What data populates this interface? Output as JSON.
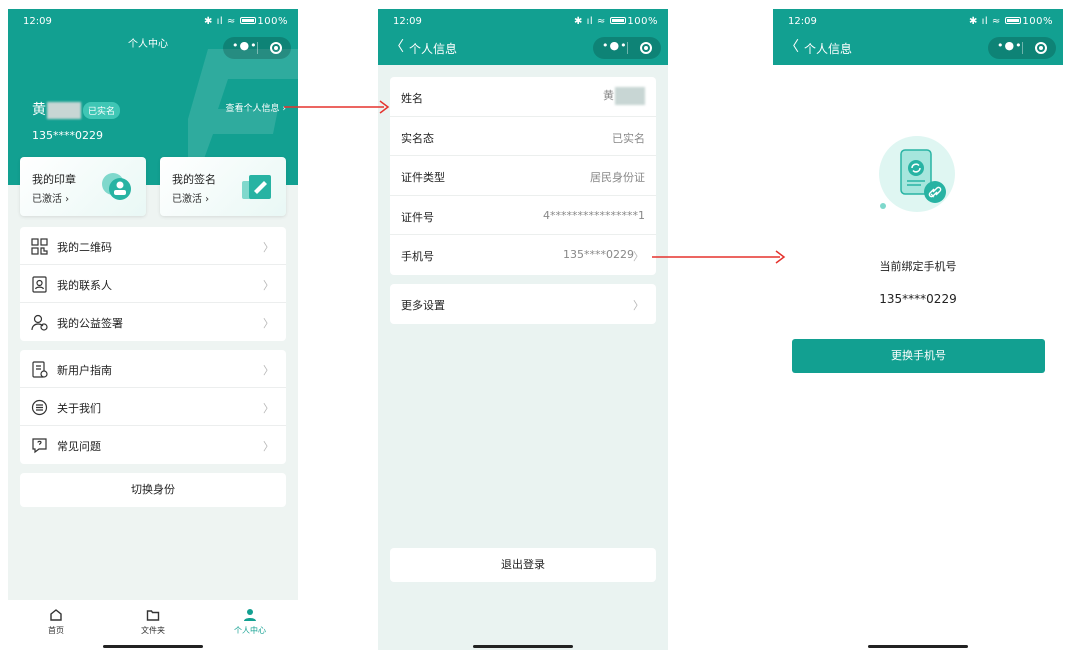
{
  "status": {
    "time": "12:09",
    "right": "100%"
  },
  "screen1": {
    "title": "个人中心",
    "name": "黄",
    "verified_badge": "已实名",
    "phone": "135****0229",
    "view_info": "查看个人信息",
    "cards": [
      {
        "title": "我的印章",
        "status": "已激活",
        "icon": "seal-icon"
      },
      {
        "title": "我的签名",
        "status": "已激活",
        "icon": "signature-icon"
      }
    ],
    "menu1": [
      {
        "label": "我的二维码",
        "icon": "qrcode-icon"
      },
      {
        "label": "我的联系人",
        "icon": "contacts-icon"
      },
      {
        "label": "我的公益签署",
        "icon": "charity-sign-icon"
      }
    ],
    "menu2": [
      {
        "label": "新用户指南",
        "icon": "guide-icon"
      },
      {
        "label": "关于我们",
        "icon": "about-icon"
      },
      {
        "label": "常见问题",
        "icon": "faq-icon"
      }
    ],
    "switch_identity": "切换身份",
    "tabs": [
      {
        "label": "首页",
        "icon": "home-icon"
      },
      {
        "label": "文件夹",
        "icon": "folder-icon"
      },
      {
        "label": "个人中心",
        "icon": "user-icon"
      }
    ]
  },
  "screen2": {
    "title": "个人信息",
    "rows": [
      {
        "key": "姓名",
        "value": "黄"
      },
      {
        "key": "实名态",
        "value": "已实名"
      },
      {
        "key": "证件类型",
        "value": "居民身份证"
      },
      {
        "key": "证件号",
        "value": "4****************1"
      },
      {
        "key": "手机号",
        "value": "135****0229"
      }
    ],
    "more_settings": "更多设置",
    "logout": "退出登录"
  },
  "screen3": {
    "title": "个人信息",
    "bound_label": "当前绑定手机号",
    "phone": "135****0229",
    "change_button": "更换手机号"
  },
  "colors": {
    "brand": "#12a091",
    "arrow": "#e5322d"
  }
}
